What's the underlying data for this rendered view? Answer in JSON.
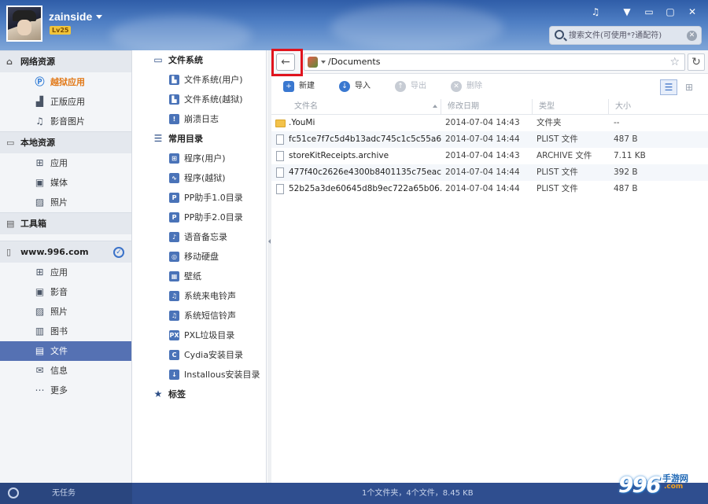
{
  "user": {
    "name": "zainside",
    "level": "Lv25"
  },
  "window_controls": [
    "♫",
    "▼",
    "▭",
    "▢",
    "✕"
  ],
  "search": {
    "placeholder": "搜索文件(可使用*?通配符)"
  },
  "left_nav": {
    "network": {
      "title": "网络资源",
      "items": [
        "越狱应用",
        "正版应用",
        "影音图片"
      ]
    },
    "local": {
      "title": "本地资源",
      "items": [
        "应用",
        "媒体",
        "照片"
      ]
    },
    "toolbox": {
      "title": "工具箱"
    },
    "device": {
      "title": "www.996.com",
      "items": [
        "应用",
        "影音",
        "照片",
        "图书",
        "文件",
        "信息",
        "更多"
      ]
    }
  },
  "tree": {
    "filesystem": {
      "title": "文件系统",
      "items": [
        "文件系统(用户)",
        "文件系统(越狱)",
        "崩溃日志"
      ]
    },
    "common": {
      "title": "常用目录",
      "items": [
        "程序(用户)",
        "程序(越狱)",
        "PP助手1.0目录",
        "PP助手2.0目录",
        "语音备忘录",
        "移动硬盘",
        "壁纸",
        "系统来电铃声",
        "系统短信铃声",
        "PXL垃圾目录",
        "Cydia安装目录",
        "Installous安装目录"
      ]
    },
    "bookmarks": {
      "title": "标签"
    }
  },
  "address": {
    "path": "/Documents"
  },
  "toolbar": {
    "new": "新建",
    "import": "导入",
    "export": "导出",
    "delete": "删除"
  },
  "table": {
    "headers": [
      "文件名",
      "修改日期",
      "类型",
      "大小"
    ],
    "rows": [
      {
        "name": ".YouMi",
        "date": "2014-07-04 14:43",
        "type": "文件夹",
        "size": "--"
      },
      {
        "name": "fc51ce7f7c5d4b13adc745c1c5c55a6...",
        "date": "2014-07-04 14:44",
        "type": "PLIST 文件",
        "size": "487 B"
      },
      {
        "name": "storeKitReceipts.archive",
        "date": "2014-07-04 14:43",
        "type": "ARCHIVE 文件",
        "size": "7.11 KB"
      },
      {
        "name": "477f40c2626e4300b8401135c75eac...",
        "date": "2014-07-04 14:44",
        "type": "PLIST 文件",
        "size": "392 B"
      },
      {
        "name": "52b25a3de60645d8b9ec722a65b06...",
        "date": "2014-07-04 14:44",
        "type": "PLIST 文件",
        "size": "487 B"
      }
    ]
  },
  "status": {
    "task": "无任务",
    "summary": "1个文件夹，4个文件，8.45 KB"
  },
  "watermark": {
    "number": "996",
    "text": "手游网",
    "domain": ".com"
  }
}
